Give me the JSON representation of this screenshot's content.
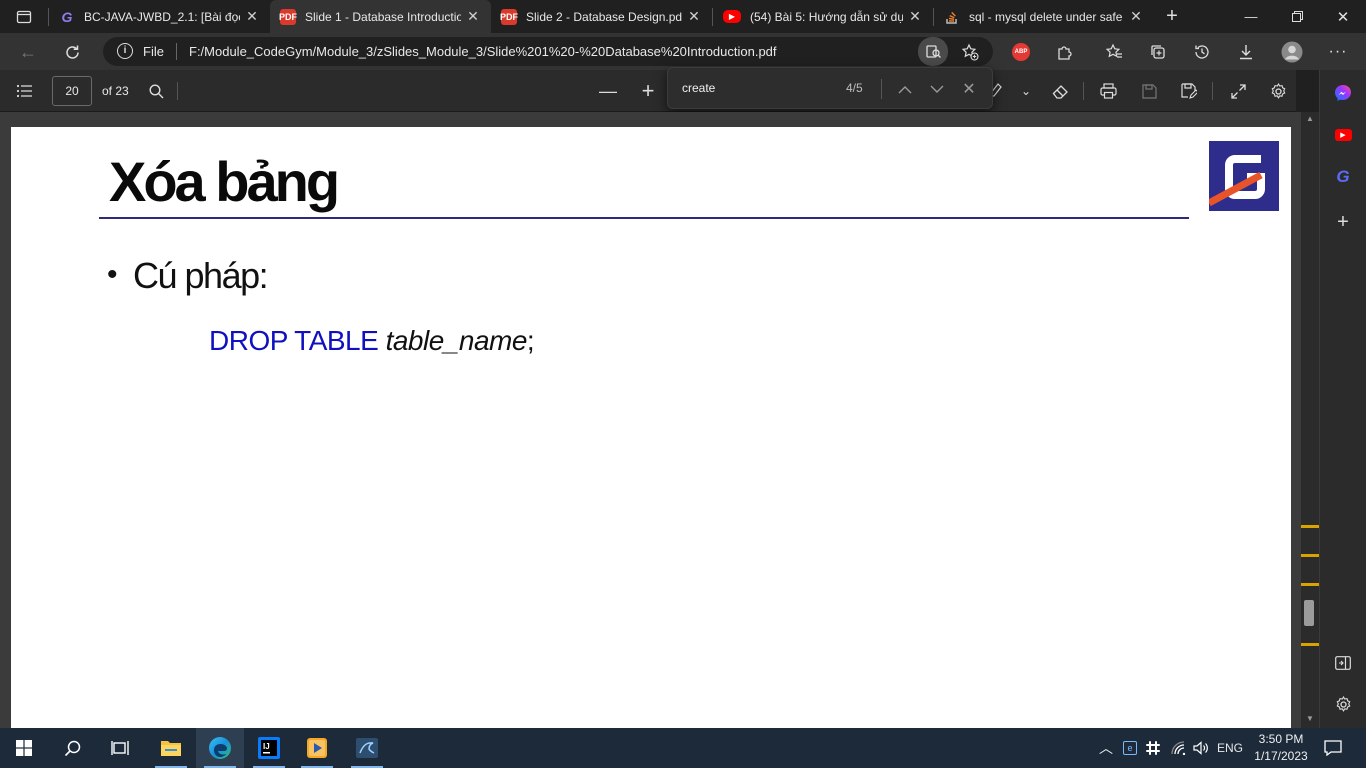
{
  "browser": {
    "tabs": [
      {
        "title": "BC-JAVA-JWBD_2.1: [Bài đọc]",
        "icon": "codegym-icon",
        "active": false
      },
      {
        "title": "Slide 1 - Database Introductio",
        "icon": "pdf-icon",
        "active": true
      },
      {
        "title": "Slide 2 - Database Design.pdf",
        "icon": "pdf-icon",
        "active": false
      },
      {
        "title": "(54) Bài 5: Hướng dẫn sử dụng",
        "icon": "youtube-icon",
        "active": false
      },
      {
        "title": "sql - mysql delete under safe",
        "icon": "stackoverflow-icon",
        "active": false
      }
    ],
    "address": {
      "scheme_label": "File",
      "url": "F:/Module_CodeGym/Module_3/zSlides_Module_3/Slide%201%20-%20Database%20Introduction.pdf"
    },
    "extension_badge": "ABP"
  },
  "pdf_toolbar": {
    "page_number": "20",
    "page_count_label": "of 23"
  },
  "find_bar": {
    "query": "create",
    "match_count": "4/5"
  },
  "slide": {
    "title": "Xóa bảng",
    "bullet": "Cú pháp:",
    "code": {
      "keyword": "DROP TABLE",
      "identifier": "table_name",
      "terminator": ";"
    }
  },
  "taskbar": {
    "language": "ENG",
    "time": "3:50 PM",
    "date": "1/17/2023"
  },
  "colors": {
    "slide_rule": "#2d2a7a",
    "code_keyword": "#1010c0",
    "logo_bg": "#2e2d8c",
    "logo_accent": "#e8542a",
    "taskbar_bg": "#1c2a3a"
  }
}
